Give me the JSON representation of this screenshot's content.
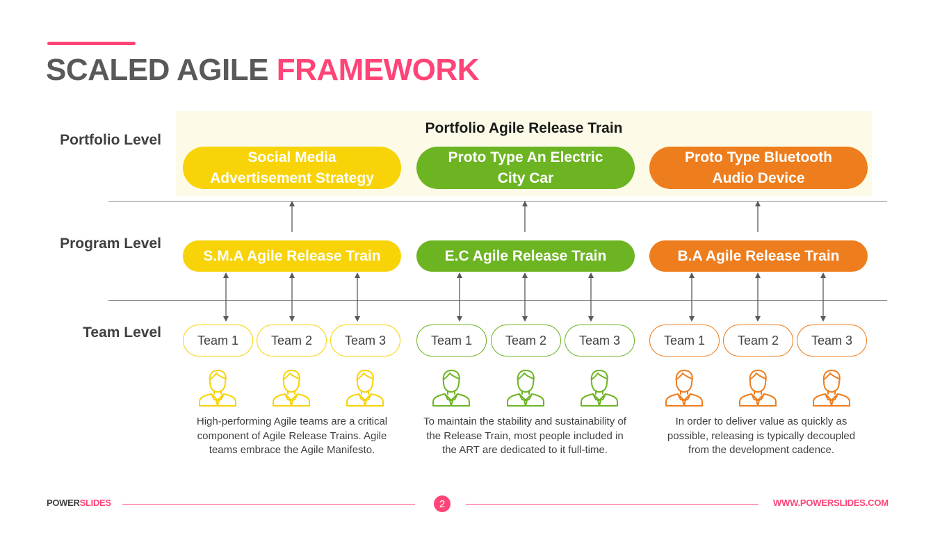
{
  "title": {
    "part1": "SCALED AGILE",
    "part2": "FRAMEWORK"
  },
  "levels": {
    "portfolio": "Portfolio Level",
    "program": "Program Level",
    "team": "Team Level"
  },
  "portfolio": {
    "title": "Portfolio Agile Release Train",
    "items": [
      {
        "line1": "Social Media",
        "line2": "Advertisement Strategy",
        "color": "#f7d308"
      },
      {
        "line1": "Proto Type An Electric",
        "line2": "City Car",
        "color": "#6db423"
      },
      {
        "line1": "Proto Type Bluetooth",
        "line2": "Audio Device",
        "color": "#ee7d1d"
      }
    ]
  },
  "program": {
    "items": [
      {
        "label": "S.M.A Agile Release Train",
        "color": "#f7d308"
      },
      {
        "label": "E.C Agile Release Train",
        "color": "#6db423"
      },
      {
        "label": "B.A Agile Release Train",
        "color": "#ee7d1d"
      }
    ]
  },
  "teams": {
    "groups": [
      {
        "color": "#f7d308",
        "members": [
          "Team 1",
          "Team 2",
          "Team 3"
        ],
        "description": "High-performing Agile teams are a critical component of Agile Release Trains. Agile teams embrace the Agile Manifesto."
      },
      {
        "color": "#6db423",
        "members": [
          "Team 1",
          "Team 2",
          "Team 3"
        ],
        "description": "To maintain the stability and sustainability of the Release Train, most people included in the ART are dedicated to it full-time."
      },
      {
        "color": "#ee7d1d",
        "members": [
          "Team 1",
          "Team 2",
          "Team 3"
        ],
        "description": "In order to deliver value as quickly as possible, releasing is typically decoupled from the development cadence."
      }
    ],
    "icon": "person-icon"
  },
  "footer": {
    "brand_part1": "POWER",
    "brand_part2": "SLIDES",
    "page_number": "2",
    "url": "WWW.POWERSLIDES.COM"
  },
  "colors": {
    "accent": "#ff4477",
    "yellow": "#f7d308",
    "green": "#6db423",
    "orange": "#ee7d1d",
    "panel": "#fdfbe7"
  }
}
